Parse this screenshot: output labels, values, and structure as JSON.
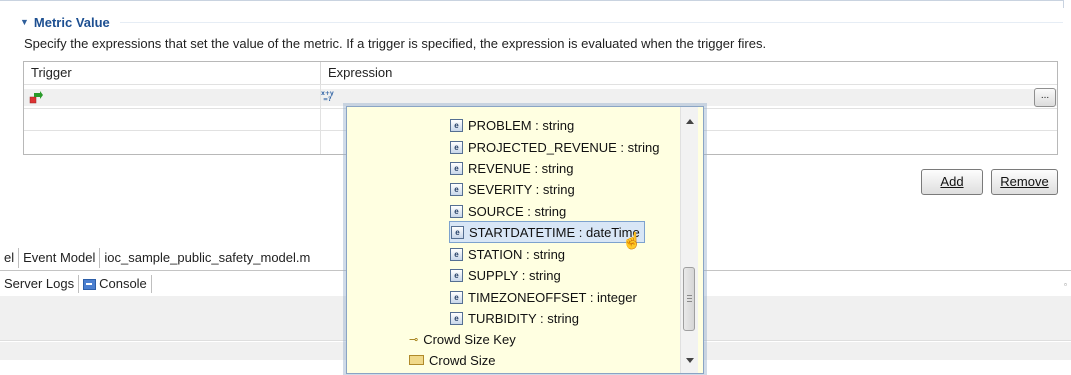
{
  "section": {
    "title": "Metric Value",
    "description": "Specify the expressions that set the value of the metric. If a trigger is specified, the expression is evaluated when the trigger fires."
  },
  "table": {
    "columns": [
      "Trigger",
      "Expression"
    ],
    "ellipsis": "..."
  },
  "buttons": {
    "add": "Add",
    "remove": "Remove"
  },
  "editor_tabs": [
    "el",
    "Event Model",
    "ioc_sample_public_safety_model.m"
  ],
  "bottom_tabs": {
    "server_logs": "Server Logs",
    "console": "Console"
  },
  "popup": {
    "items": [
      {
        "label": "PROBLEM : string",
        "icon": "element-icon"
      },
      {
        "label": "PROJECTED_REVENUE : string",
        "icon": "element-icon"
      },
      {
        "label": "REVENUE : string",
        "icon": "element-icon"
      },
      {
        "label": "SEVERITY : string",
        "icon": "element-icon"
      },
      {
        "label": "SOURCE : string",
        "icon": "element-icon"
      },
      {
        "label": "STARTDATETIME : dateTime",
        "icon": "element-icon",
        "selected": true
      },
      {
        "label": "STATION : string",
        "icon": "element-icon"
      },
      {
        "label": "SUPPLY : string",
        "icon": "element-icon"
      },
      {
        "label": "TIMEZONEOFFSET : integer",
        "icon": "element-icon"
      },
      {
        "label": "TURBIDITY : string",
        "icon": "element-icon"
      },
      {
        "label": "Crowd Size Key",
        "icon": "key-icon"
      },
      {
        "label": "Crowd Size",
        "icon": "ruler-icon"
      }
    ]
  },
  "colors": {
    "popup_background": "#ffffe1",
    "section_title": "#1d4f91",
    "selection": "#d8e6f6"
  }
}
